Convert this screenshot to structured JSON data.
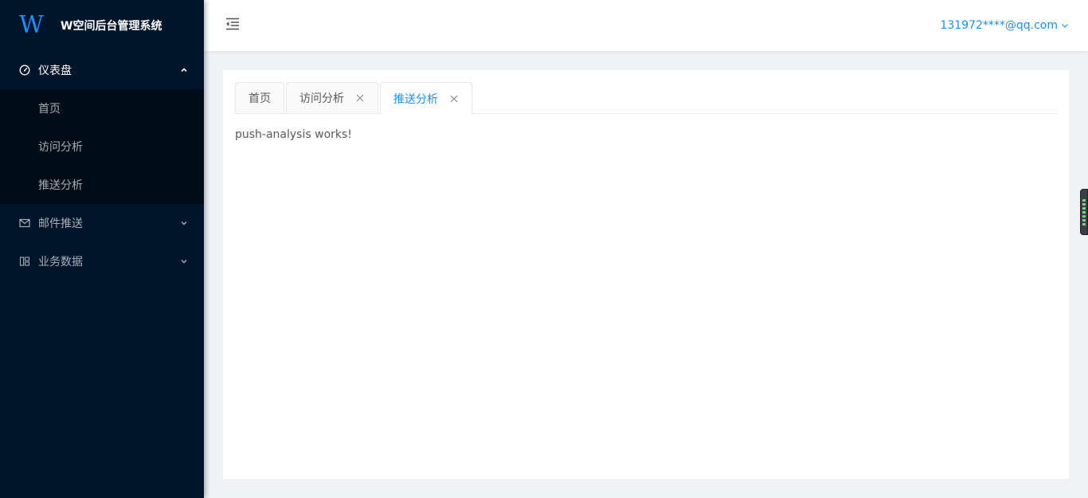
{
  "app": {
    "logo_text": "W",
    "title": "W空间后台管理系统"
  },
  "sidebar": {
    "menus": [
      {
        "label": "仪表盘",
        "icon": "dashboard-icon",
        "open": true,
        "children": [
          {
            "label": "首页"
          },
          {
            "label": "访问分析"
          },
          {
            "label": "推送分析"
          }
        ]
      },
      {
        "label": "邮件推送",
        "icon": "mail-icon",
        "open": false
      },
      {
        "label": "业务数据",
        "icon": "appstore-icon",
        "open": false
      }
    ]
  },
  "header": {
    "collapse_icon": "menu-fold-icon",
    "user_email": "131972****@qq.com"
  },
  "tabs": [
    {
      "label": "首页",
      "closable": false,
      "active": false
    },
    {
      "label": "访问分析",
      "closable": true,
      "active": false
    },
    {
      "label": "推送分析",
      "closable": true,
      "active": true
    }
  ],
  "page": {
    "text": "push-analysis works!"
  },
  "colors": {
    "sidebar_bg": "#001529",
    "submenu_bg": "#000c17",
    "accent": "#1890ff",
    "content_bg": "#f0f2f5"
  }
}
